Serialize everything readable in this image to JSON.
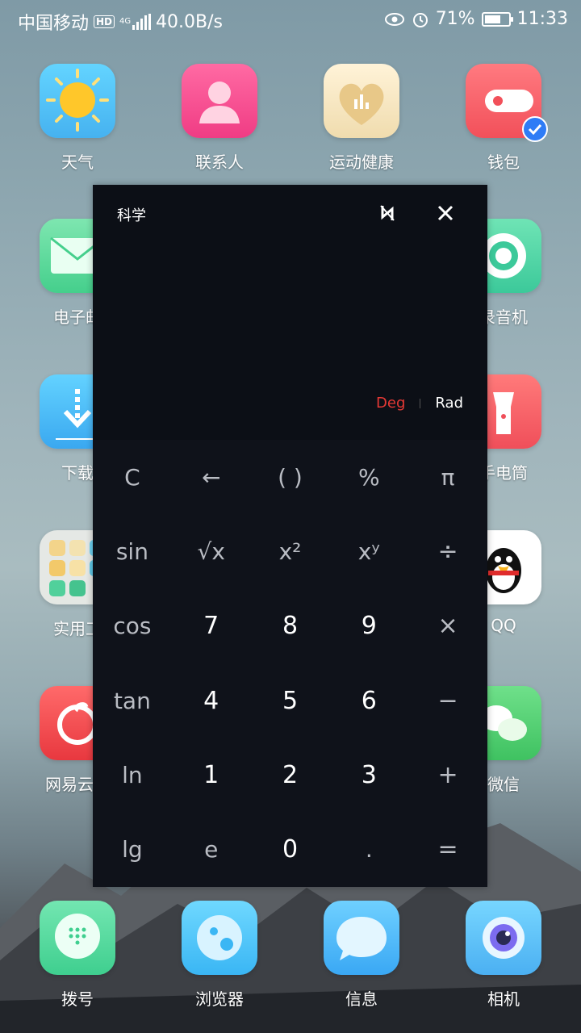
{
  "status_bar": {
    "carrier": "中国移动",
    "hd": "HD",
    "network": "4G",
    "speed": "40.0B/s",
    "battery_percent": "71%",
    "battery_level": 0.71,
    "time": "11:33"
  },
  "apps": {
    "weather": "天气",
    "contacts": "联系人",
    "health": "运动健康",
    "wallet": "钱包",
    "email": "电子邮",
    "recorder": "录音机",
    "downloads": "下载",
    "flashlight": "手电筒",
    "tools": "实用工",
    "qq": "QQ",
    "netease": "网易云音",
    "wechat": "微信",
    "dialer": "拨号",
    "browser": "浏览器",
    "messages": "信息",
    "camera": "相机"
  },
  "calculator": {
    "title": "科学",
    "deg_label": "Deg",
    "rad_label": "Rad",
    "active_mode": "Deg",
    "accent_color": "#e53935",
    "keys": {
      "clear": "C",
      "backspace": "←",
      "parens": "( )",
      "percent": "%",
      "pi": "π",
      "sin": "sin",
      "sqrt": "√x",
      "square": "x²",
      "power": "xʸ",
      "divide": "÷",
      "cos": "cos",
      "seven": "7",
      "eight": "8",
      "nine": "9",
      "multiply": "×",
      "tan": "tan",
      "four": "4",
      "five": "5",
      "six": "6",
      "minus": "−",
      "ln": "ln",
      "one": "1",
      "two": "2",
      "three": "3",
      "plus": "+",
      "lg": "lg",
      "e": "e",
      "zero": "0",
      "dot": ".",
      "equals": "="
    }
  }
}
